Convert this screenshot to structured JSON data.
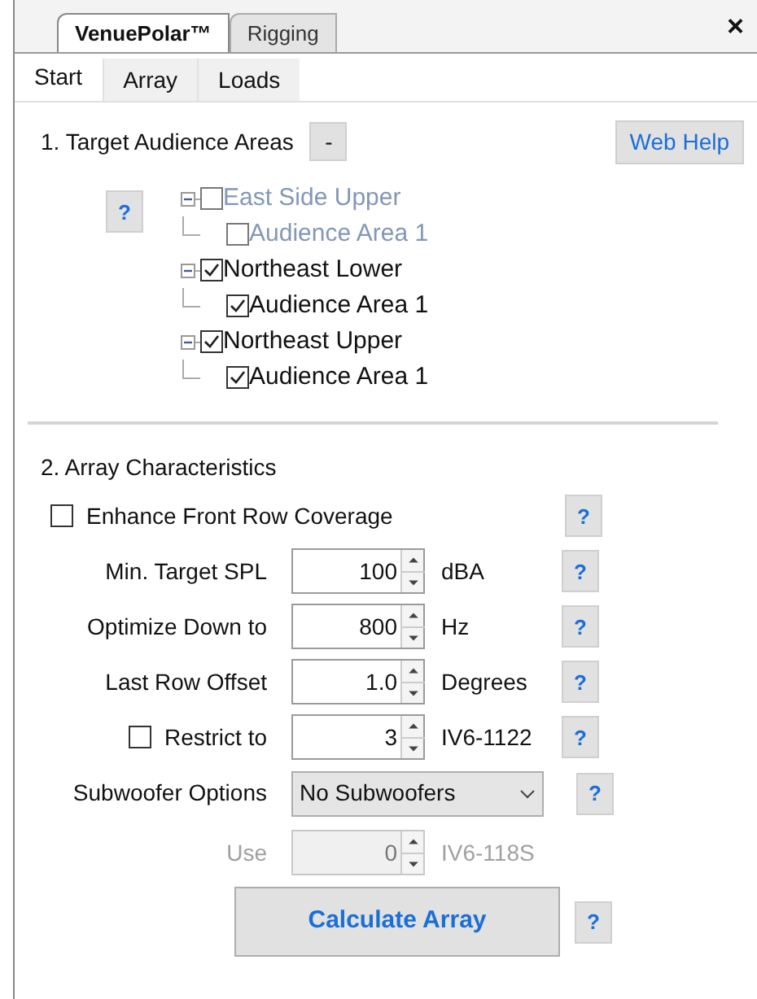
{
  "tabs": [
    {
      "label": "VenuePolar™",
      "selected": true
    },
    {
      "label": "Rigging",
      "selected": false
    }
  ],
  "close": "×",
  "subtabs": [
    {
      "label": "Start",
      "selected": true
    },
    {
      "label": "Array",
      "selected": false
    },
    {
      "label": "Loads",
      "selected": false
    }
  ],
  "section1": {
    "title": "1. Target Audience Areas",
    "collapse": "-",
    "web_help": "Web Help",
    "help": "?"
  },
  "tree": [
    {
      "label": "East Side Upper",
      "checked": false,
      "disabled": true,
      "expanded": true,
      "children": [
        {
          "label": "Audience Area 1",
          "checked": false,
          "disabled": true
        }
      ]
    },
    {
      "label": "Northeast Lower",
      "checked": true,
      "disabled": false,
      "expanded": true,
      "children": [
        {
          "label": "Audience Area 1",
          "checked": true,
          "disabled": false
        }
      ]
    },
    {
      "label": "Northeast Upper",
      "checked": true,
      "disabled": false,
      "expanded": true,
      "children": [
        {
          "label": "Audience Area 1",
          "checked": true,
          "disabled": false
        }
      ]
    }
  ],
  "section2": {
    "title": "2. Array Characteristics"
  },
  "rows": [
    {
      "kind": "checkbox",
      "label": "Enhance Front Row Coverage",
      "checked": false,
      "help": "?"
    },
    {
      "kind": "spin",
      "label": "Min. Target SPL",
      "value": "100",
      "unit": "dBA",
      "disabled": false,
      "help": "?"
    },
    {
      "kind": "spin",
      "label": "Optimize Down to",
      "value": "800",
      "unit": "Hz",
      "disabled": false,
      "help": "?"
    },
    {
      "kind": "spin",
      "label": "Last Row Offset",
      "value": "1.0",
      "unit": "Degrees",
      "disabled": false,
      "help": "?"
    },
    {
      "kind": "checkspin",
      "label": "Restrict to",
      "checked": false,
      "value": "3",
      "unit": "IV6-1122",
      "disabled": false,
      "help": "?"
    },
    {
      "kind": "select",
      "label": "Subwoofer Options",
      "value": "No Subwoofers",
      "help": "?"
    },
    {
      "kind": "spin",
      "label": "Use",
      "value": "0",
      "unit": "IV6-118S",
      "disabled": true
    }
  ],
  "calculate": {
    "label": "Calculate Array",
    "help": "?"
  }
}
